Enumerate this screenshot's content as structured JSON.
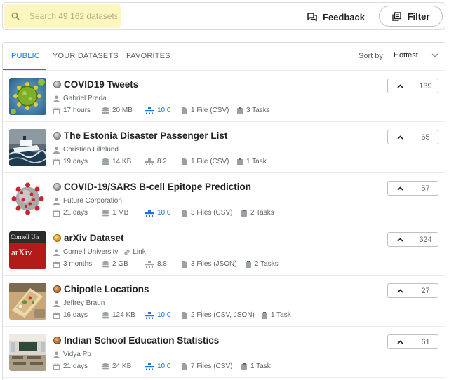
{
  "search": {
    "placeholder": "Search 49,162 datasets"
  },
  "header": {
    "feedback_label": "Feedback",
    "filter_label": "Filter"
  },
  "tabs": [
    {
      "label": "PUBLIC",
      "active": true
    },
    {
      "label": "YOUR DATASETS",
      "active": false
    },
    {
      "label": "FAVORITES",
      "active": false
    }
  ],
  "sort": {
    "label": "Sort by:",
    "value": "Hottest"
  },
  "colors": {
    "accent": "#1a73e8",
    "search_bg": "#fdf6bf"
  },
  "datasets": [
    {
      "title": "COVID19 Tweets",
      "medal": "silver",
      "owner": "Gabriel Preda",
      "link": "",
      "updated": "17 hours",
      "size": "20 MB",
      "usability": "10.0",
      "usability_high": true,
      "files": "1 File (CSV)",
      "tasks": "3 Tasks",
      "votes": "139",
      "thumb": "virus-green"
    },
    {
      "title": "The Estonia Disaster Passenger List",
      "medal": "silver",
      "owner": "Christian Lillelund",
      "link": "",
      "updated": "19 days",
      "size": "14 KB",
      "usability": "8.2",
      "usability_high": false,
      "files": "1 File (CSV)",
      "tasks": "1 Task",
      "votes": "65",
      "thumb": "ship-storm"
    },
    {
      "title": "COVID-19/SARS B-cell Epitope Prediction",
      "medal": "silver",
      "owner": "Future Corporation",
      "link": "",
      "updated": "21 days",
      "size": "1 MB",
      "usability": "10.0",
      "usability_high": true,
      "files": "3 Files (CSV)",
      "tasks": "2 Tasks",
      "votes": "57",
      "thumb": "virus-red"
    },
    {
      "title": "arXiv Dataset",
      "medal": "gold",
      "owner": "Cornell University",
      "link": "Link",
      "updated": "3 months",
      "size": "2 GB",
      "usability": "8.8",
      "usability_high": false,
      "files": "3 Files (JSON)",
      "tasks": "2 Tasks",
      "votes": "324",
      "thumb": "arxiv",
      "thumb_text": {
        "top": "Cornell Un",
        "main": "arXiv"
      }
    },
    {
      "title": "Chipotle Locations",
      "medal": "bronze",
      "owner": "Jeffrey Braun",
      "link": "",
      "updated": "16 days",
      "size": "124 KB",
      "usability": "10.0",
      "usability_high": true,
      "files": "2 Files (CSV, JSON)",
      "tasks": "1 Task",
      "votes": "27",
      "thumb": "burrito"
    },
    {
      "title": "Indian School Education Statistics",
      "medal": "bronze",
      "owner": "Vidya Pb",
      "link": "",
      "updated": "21 days",
      "size": "24 KB",
      "usability": "10.0",
      "usability_high": true,
      "files": "7 Files (CSV)",
      "tasks": "1 Task",
      "votes": "61",
      "thumb": "classroom"
    }
  ]
}
